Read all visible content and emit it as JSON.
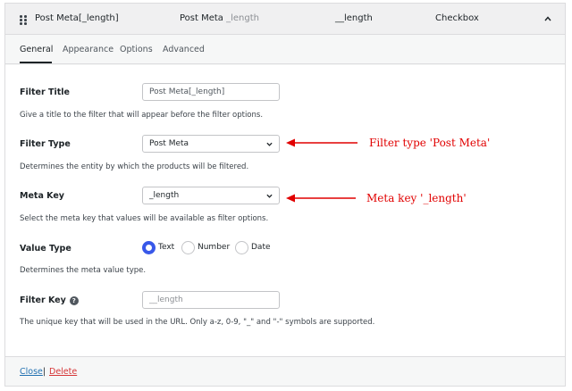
{
  "header": {
    "title": "Post Meta[_length]",
    "source_main": "Post Meta",
    "source_muted": "_length",
    "meta_key": "__length",
    "type": "Checkbox"
  },
  "tabs": [
    {
      "label": "General",
      "active": true
    },
    {
      "label": "Appearance",
      "active": false
    },
    {
      "label": "Options",
      "active": false
    },
    {
      "label": "Advanced",
      "active": false
    }
  ],
  "fields": {
    "filter_title": {
      "label": "Filter Title",
      "value": "Post Meta[_length]",
      "description": "Give a title to the filter that will appear before the filter options."
    },
    "filter_type": {
      "label": "Filter Type",
      "value": "Post Meta",
      "description": "Determines the entity by which the products will be filtered."
    },
    "meta_key": {
      "label": "Meta Key",
      "value": "_length",
      "description": "Select the meta key that values will be available as filter options."
    },
    "value_type": {
      "label": "Value Type",
      "options": [
        {
          "label": "Text",
          "checked": true
        },
        {
          "label": "Number",
          "checked": false
        },
        {
          "label": "Date",
          "checked": false
        }
      ],
      "description": "Determines the meta value type."
    },
    "filter_key": {
      "label": "Filter Key",
      "placeholder": "__length",
      "description": "The unique key that will be used in the URL. Only a-z, 0-9, \"_\" and \"-\" symbols are supported."
    }
  },
  "annotations": {
    "filter_type_note": "Filter type 'Post Meta'",
    "meta_key_note": "Meta key '_length'"
  },
  "footer": {
    "close_label": "Close",
    "separator": "|",
    "delete_label": "Delete"
  },
  "colors": {
    "accent": "#3858e9",
    "link": "#2271b1",
    "danger": "#d63638",
    "annotation": "#e10000"
  },
  "icons": {
    "drag": "drag-handle-icon",
    "collapse": "chevron-up-icon",
    "select": "chevron-down-icon",
    "help": "help-icon",
    "arrow": "arrow-left-icon"
  }
}
